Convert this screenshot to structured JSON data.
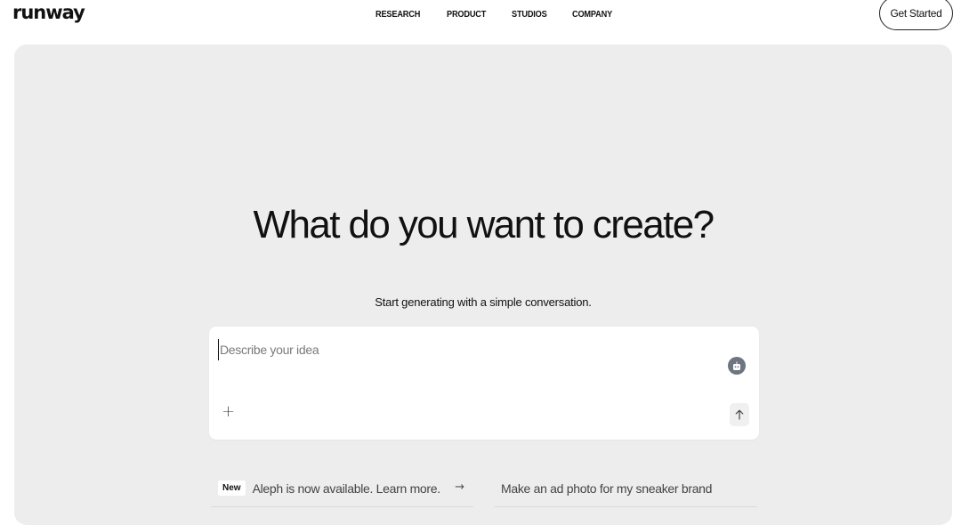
{
  "brand": {
    "logo_text": "runway"
  },
  "nav": {
    "items": [
      "RESEARCH",
      "PRODUCT",
      "STUDIOS",
      "COMPANY"
    ]
  },
  "header": {
    "cta_label": "Get Started"
  },
  "hero": {
    "headline": "What do you want to create?",
    "subheadline": "Start generating with a simple conversation."
  },
  "prompt": {
    "placeholder": "Describe your idea",
    "value": "",
    "icons": {
      "assistant": "robot-icon",
      "attach": "plus-icon",
      "send": "arrow-up-icon"
    }
  },
  "suggestions": [
    {
      "badge": "New",
      "text": "Aleph is now available. Learn more.",
      "icon": "arrow-right-icon"
    },
    {
      "text": "Make an ad photo for my sneaker brand"
    }
  ],
  "colors": {
    "hero_bg": "#eeedee",
    "card_bg": "#ffffff",
    "assistant_icon_bg": "#6d7582"
  }
}
